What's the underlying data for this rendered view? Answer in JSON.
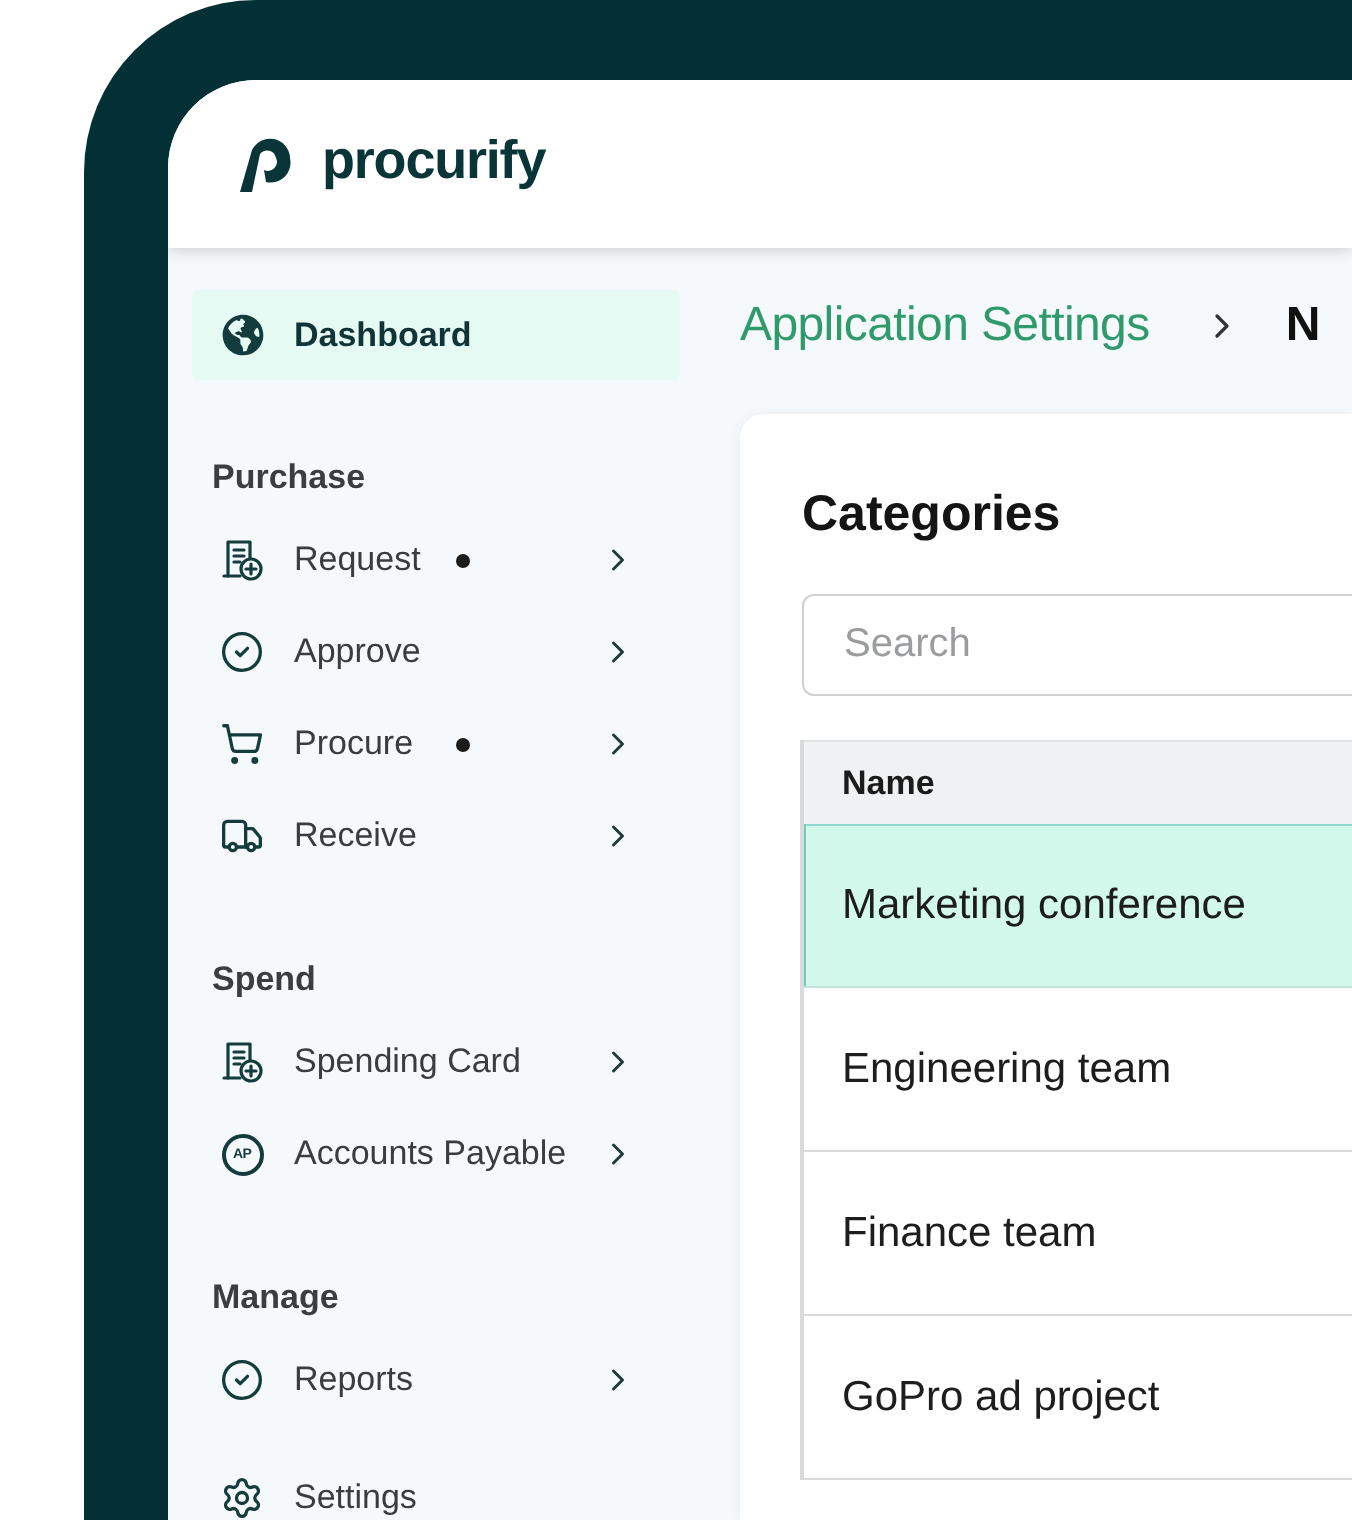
{
  "header": {
    "logo_text": "procurify"
  },
  "sidebar": {
    "items": [
      {
        "label": "Dashboard",
        "selected": true
      }
    ],
    "sections": [
      {
        "heading": "Purchase",
        "items": [
          {
            "label": "Request",
            "notification": true,
            "expandable": true,
            "selected": false
          },
          {
            "label": "Approve",
            "notification": false,
            "expandable": true,
            "selected": false
          },
          {
            "label": "Procure",
            "notification": true,
            "expandable": true,
            "selected": false
          },
          {
            "label": "Receive",
            "notification": false,
            "expandable": true,
            "selected": false
          }
        ]
      },
      {
        "heading": "Spend",
        "items": [
          {
            "label": "Spending Card",
            "notification": false,
            "expandable": true,
            "selected": false
          },
          {
            "label": "Accounts Payable",
            "icon_text": "AP",
            "notification": false,
            "expandable": true,
            "selected": false
          }
        ]
      },
      {
        "heading": "Manage",
        "items": [
          {
            "label": "Reports",
            "notification": false,
            "expandable": true,
            "selected": false
          }
        ]
      },
      {
        "items": [
          {
            "label": "Settings",
            "notification": false,
            "expandable": false,
            "selected": false
          }
        ]
      }
    ]
  },
  "breadcrumb": [
    {
      "label": "Application Settings"
    },
    {
      "label": "N"
    }
  ],
  "card": {
    "title": "Categories",
    "search": {
      "placeholder": "Search"
    },
    "table": {
      "columns": [
        "Name"
      ],
      "rows": [
        {
          "cells": [
            "Marketing conference"
          ],
          "selected": true
        },
        {
          "cells": [
            "Engineering team"
          ],
          "selected": false
        },
        {
          "cells": [
            "Finance team"
          ],
          "selected": false
        },
        {
          "cells": [
            "GoPro ad project"
          ],
          "selected": false
        }
      ]
    }
  }
}
